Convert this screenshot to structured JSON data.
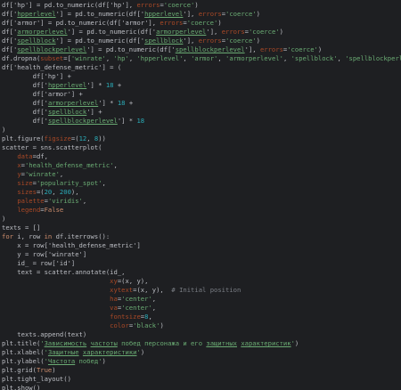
{
  "editor": {
    "language": "python",
    "colors": {
      "background": "#1e1f22",
      "default": "#bcbec4",
      "string": "#6aab73",
      "keyword": "#cf8e6d",
      "number": "#2aacb8",
      "param": "#aa4926",
      "comment": "#7a7e85"
    },
    "lines": [
      [
        [
          "id",
          "df['hp'] = pd.to_numeric(df['hp'], "
        ],
        [
          "param",
          "errors"
        ],
        [
          "id",
          "="
        ],
        [
          "str",
          "'coerce'"
        ],
        [
          "id",
          ")"
        ]
      ],
      [
        [
          "id",
          "df['"
        ],
        [
          "strul",
          "hpperlevel"
        ],
        [
          "id",
          "'] = pd.to_numeric(df['"
        ],
        [
          "strul",
          "hpperlevel"
        ],
        [
          "id",
          "'], "
        ],
        [
          "param",
          "errors"
        ],
        [
          "id",
          "="
        ],
        [
          "str",
          "'coerce'"
        ],
        [
          "id",
          ")"
        ]
      ],
      [
        [
          "id",
          "df['armor'] = pd.to_numeric(df['armor'], "
        ],
        [
          "param",
          "errors"
        ],
        [
          "id",
          "="
        ],
        [
          "str",
          "'coerce'"
        ],
        [
          "id",
          ")"
        ]
      ],
      [
        [
          "id",
          "df['"
        ],
        [
          "strul",
          "armorperlevel"
        ],
        [
          "id",
          "'] = pd.to_numeric(df['"
        ],
        [
          "strul",
          "armorperlevel"
        ],
        [
          "id",
          "'], "
        ],
        [
          "param",
          "errors"
        ],
        [
          "id",
          "="
        ],
        [
          "str",
          "'coerce'"
        ],
        [
          "id",
          ")"
        ]
      ],
      [
        [
          "id",
          "df['"
        ],
        [
          "strul",
          "spellblock"
        ],
        [
          "id",
          "'] = pd.to_numeric(df['"
        ],
        [
          "strul",
          "spellblock"
        ],
        [
          "id",
          "'], "
        ],
        [
          "param",
          "errors"
        ],
        [
          "id",
          "="
        ],
        [
          "str",
          "'coerce'"
        ],
        [
          "id",
          ")"
        ]
      ],
      [
        [
          "id",
          "df['"
        ],
        [
          "strul",
          "spellblockperlevel"
        ],
        [
          "id",
          "'] = pd.to_numeric(df['"
        ],
        [
          "strul",
          "spellblockperlevel"
        ],
        [
          "id",
          "'], "
        ],
        [
          "param",
          "errors"
        ],
        [
          "id",
          "="
        ],
        [
          "str",
          "'coerce'"
        ],
        [
          "id",
          ")"
        ]
      ],
      [
        [
          "id",
          "df.dropna("
        ],
        [
          "param",
          "subset"
        ],
        [
          "id",
          "=["
        ],
        [
          "str",
          "'winrate'"
        ],
        [
          "id",
          ", "
        ],
        [
          "str",
          "'hp'"
        ],
        [
          "id",
          ", "
        ],
        [
          "str",
          "'hpperlevel'"
        ],
        [
          "id",
          ", "
        ],
        [
          "str",
          "'armor'"
        ],
        [
          "id",
          ", "
        ],
        [
          "str",
          "'armorperlevel'"
        ],
        [
          "id",
          ", "
        ],
        [
          "str",
          "'spellblock'"
        ],
        [
          "id",
          ", "
        ],
        [
          "str",
          "'spellblockperlevel'"
        ],
        [
          "id",
          "],"
        ],
        [
          "param",
          "inplace"
        ],
        [
          "id",
          "="
        ],
        [
          "kw",
          "True"
        ],
        [
          "id",
          ")"
        ]
      ],
      [
        [
          "id",
          "df['health_defense_metric'] = ("
        ]
      ],
      [
        [
          "id",
          "        df['hp'] +"
        ]
      ],
      [
        [
          "id",
          "        df['"
        ],
        [
          "strul",
          "hpperlevel"
        ],
        [
          "id",
          "'] * "
        ],
        [
          "num",
          "18"
        ],
        [
          "id",
          " +"
        ]
      ],
      [
        [
          "id",
          "        df['armor'] +"
        ]
      ],
      [
        [
          "id",
          "        df['"
        ],
        [
          "strul",
          "armorperlevel"
        ],
        [
          "id",
          "'] * "
        ],
        [
          "num",
          "18"
        ],
        [
          "id",
          " +"
        ]
      ],
      [
        [
          "id",
          "        df['"
        ],
        [
          "strul",
          "spellblock"
        ],
        [
          "id",
          "'] +"
        ]
      ],
      [
        [
          "id",
          "        df['"
        ],
        [
          "strul",
          "spellblockperlevel"
        ],
        [
          "id",
          "'] * "
        ],
        [
          "num",
          "18"
        ]
      ],
      [
        [
          "id",
          ")"
        ]
      ],
      [
        [
          "id",
          "plt.figure("
        ],
        [
          "param",
          "figsize"
        ],
        [
          "id",
          "=("
        ],
        [
          "num",
          "12"
        ],
        [
          "id",
          ", "
        ],
        [
          "num",
          "8"
        ],
        [
          "id",
          "))"
        ]
      ],
      [
        [
          "id",
          "scatter = sns.scatterplot("
        ]
      ],
      [
        [
          "id",
          "    "
        ],
        [
          "param",
          "data"
        ],
        [
          "id",
          "=df,"
        ]
      ],
      [
        [
          "id",
          "    "
        ],
        [
          "param",
          "x"
        ],
        [
          "id",
          "="
        ],
        [
          "str",
          "'health_defense_metric'"
        ],
        [
          "id",
          ","
        ]
      ],
      [
        [
          "id",
          "    "
        ],
        [
          "param",
          "y"
        ],
        [
          "id",
          "="
        ],
        [
          "str",
          "'winrate'"
        ],
        [
          "id",
          ","
        ]
      ],
      [
        [
          "id",
          "    "
        ],
        [
          "param",
          "size"
        ],
        [
          "id",
          "="
        ],
        [
          "str",
          "'popularity_spot'"
        ],
        [
          "id",
          ","
        ]
      ],
      [
        [
          "id",
          "    "
        ],
        [
          "param",
          "sizes"
        ],
        [
          "id",
          "=("
        ],
        [
          "num",
          "20"
        ],
        [
          "id",
          ", "
        ],
        [
          "num",
          "200"
        ],
        [
          "id",
          "),"
        ]
      ],
      [
        [
          "id",
          "    "
        ],
        [
          "param",
          "palette"
        ],
        [
          "id",
          "="
        ],
        [
          "str",
          "'viridis'"
        ],
        [
          "id",
          ","
        ]
      ],
      [
        [
          "id",
          "    "
        ],
        [
          "param",
          "legend"
        ],
        [
          "id",
          "="
        ],
        [
          "kw",
          "False"
        ]
      ],
      [
        [
          "id",
          ")"
        ]
      ],
      [
        [
          "id",
          "texts = []"
        ]
      ],
      [
        [
          "kw",
          "for"
        ],
        [
          "id",
          " i, row "
        ],
        [
          "kw",
          "in"
        ],
        [
          "id",
          " df.iterrows():"
        ]
      ],
      [
        [
          "id",
          "    x = row['health_defense_metric']"
        ]
      ],
      [
        [
          "id",
          "    y = row['winrate']"
        ]
      ],
      [
        [
          "id",
          "    id_ = row['id']"
        ]
      ],
      [
        [
          "id",
          "    text = scatter.annotate(id_,"
        ]
      ],
      [
        [
          "id",
          "                            "
        ],
        [
          "param",
          "xy"
        ],
        [
          "id",
          "=(x, y),"
        ]
      ],
      [
        [
          "id",
          "                            "
        ],
        [
          "param",
          "xytext"
        ],
        [
          "id",
          "=(x, y),"
        ],
        [
          "comment",
          "  # Initial position"
        ]
      ],
      [
        [
          "id",
          "                            "
        ],
        [
          "param",
          "ha"
        ],
        [
          "id",
          "="
        ],
        [
          "str",
          "'center'"
        ],
        [
          "id",
          ","
        ]
      ],
      [
        [
          "id",
          "                            "
        ],
        [
          "param",
          "va"
        ],
        [
          "id",
          "="
        ],
        [
          "str",
          "'center'"
        ],
        [
          "id",
          ","
        ]
      ],
      [
        [
          "id",
          "                            "
        ],
        [
          "param",
          "fontsize"
        ],
        [
          "id",
          "="
        ],
        [
          "num",
          "8"
        ],
        [
          "id",
          ","
        ]
      ],
      [
        [
          "id",
          "                            "
        ],
        [
          "param",
          "color"
        ],
        [
          "id",
          "="
        ],
        [
          "str",
          "'black'"
        ],
        [
          "id",
          ")"
        ]
      ],
      [
        [
          "id",
          "    texts.append(text)"
        ]
      ],
      [
        [
          "id",
          "plt.title("
        ],
        [
          "str",
          "'"
        ],
        [
          "strul",
          "Зависимость"
        ],
        [
          "str",
          " "
        ],
        [
          "strul",
          "частоты"
        ],
        [
          "str",
          " побед персонажа и его "
        ],
        [
          "strul",
          "защитных"
        ],
        [
          "str",
          " "
        ],
        [
          "strul",
          "характеристик"
        ],
        [
          "str",
          "'"
        ],
        [
          "id",
          ")"
        ]
      ],
      [
        [
          "id",
          "plt.xlabel("
        ],
        [
          "str",
          "'"
        ],
        [
          "strul",
          "Защитные"
        ],
        [
          "str",
          " "
        ],
        [
          "strul",
          "характеристики"
        ],
        [
          "str",
          "'"
        ],
        [
          "id",
          ")"
        ]
      ],
      [
        [
          "id",
          "plt.ylabel("
        ],
        [
          "str",
          "'"
        ],
        [
          "strul",
          "Частота"
        ],
        [
          "str",
          " побед'"
        ],
        [
          "id",
          ")"
        ]
      ],
      [
        [
          "id",
          "plt.grid("
        ],
        [
          "kw",
          "True"
        ],
        [
          "id",
          ")"
        ]
      ],
      [
        [
          "id",
          "plt.tight_layout()"
        ]
      ],
      [
        [
          "id",
          "plt.show()"
        ]
      ]
    ]
  }
}
